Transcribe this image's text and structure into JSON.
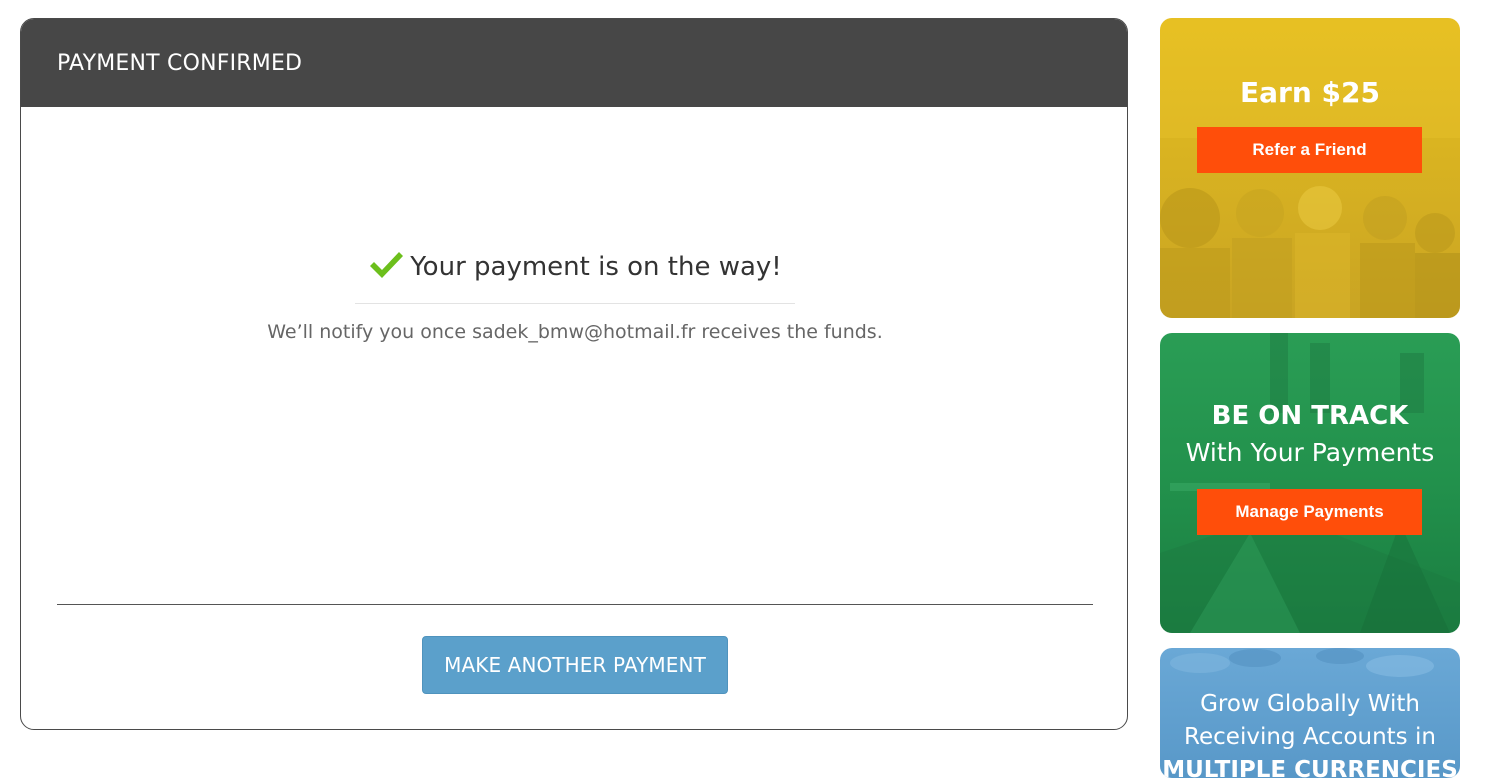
{
  "payment_card": {
    "header_title": "PAYMENT CONFIRMED",
    "confirmation_title": "Your payment is on the way!",
    "notify_text": "We’ll notify you once sadek_bmw@hotmail.fr receives the funds.",
    "make_another_payment_label": "MAKE ANOTHER PAYMENT"
  },
  "promos": {
    "referral": {
      "heading": "Earn $25",
      "button_label": "Refer a Friend",
      "background_color": "#e0b920",
      "button_color": "#ff4e0a"
    },
    "track": {
      "heading": "BE ON TRACK",
      "subheading": "With Your Payments",
      "button_label": "Manage Payments",
      "background_color": "#22914c",
      "button_color": "#ff4e0a"
    },
    "grow": {
      "text_line_1": "Grow Globally With",
      "text_line_2": "Receiving Accounts in",
      "text_line_3": "MULTIPLE CURRENCIES",
      "background_color": "#5f9fcf"
    }
  },
  "colors": {
    "header_bg": "#474747",
    "check_green": "#6cbf1c",
    "primary_button": "#5ba0cb"
  }
}
